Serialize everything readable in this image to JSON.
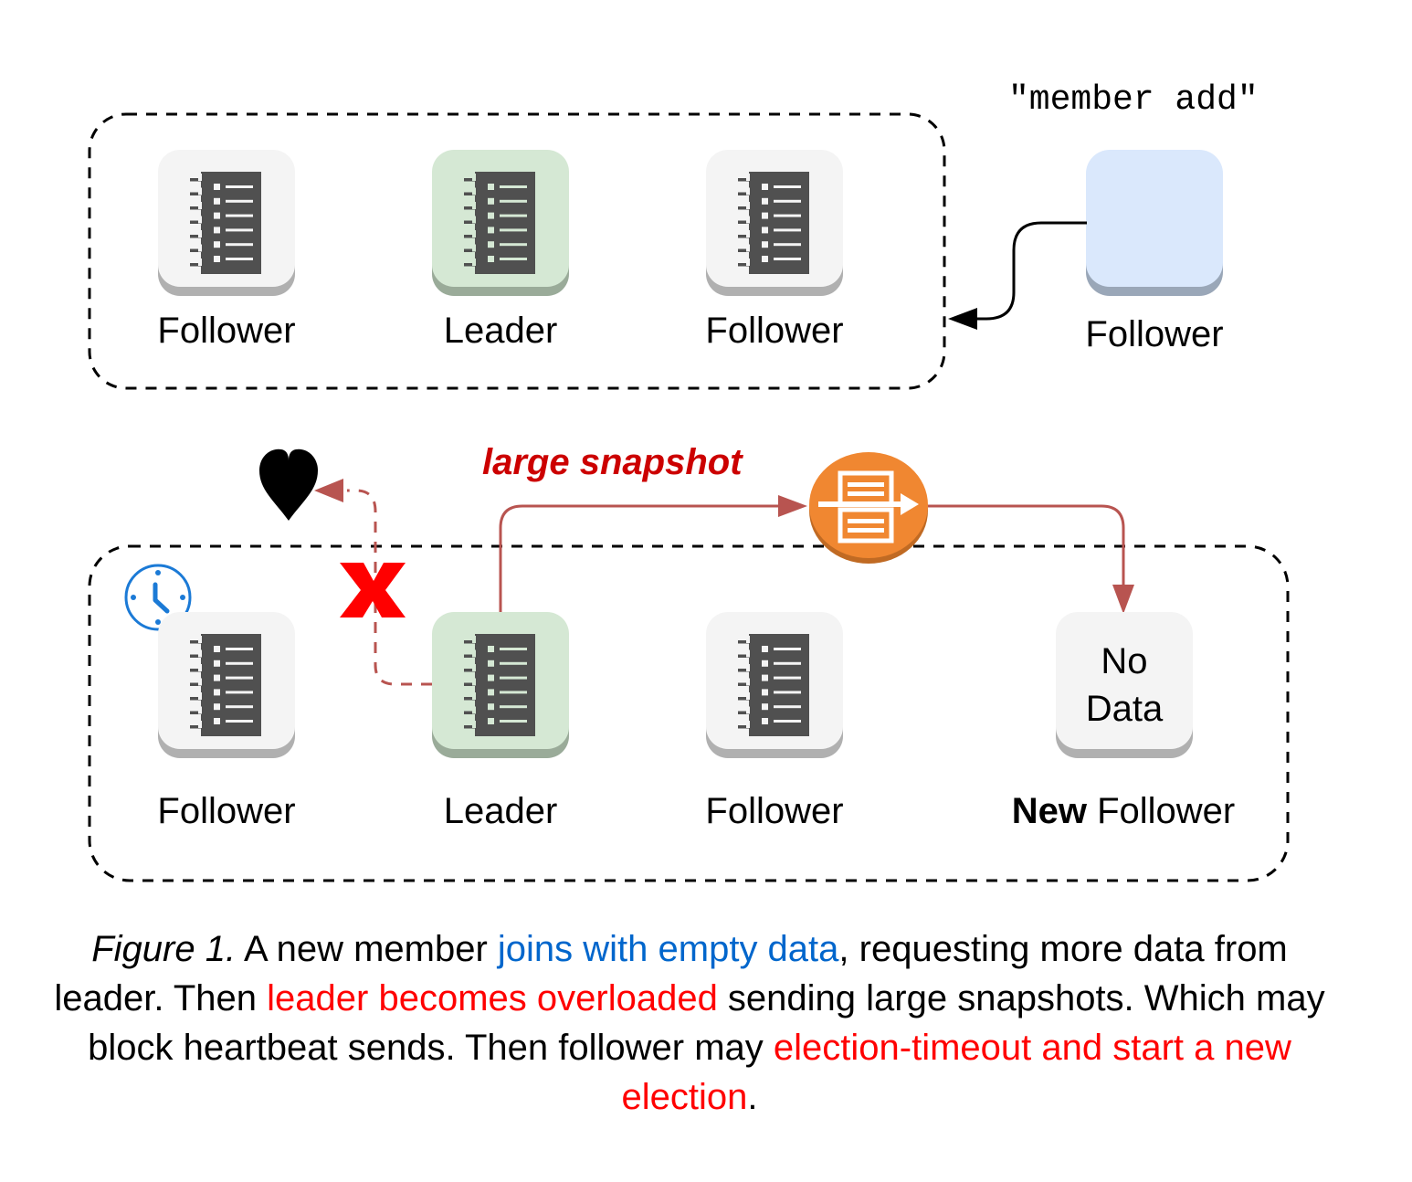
{
  "diagram": {
    "top_cluster": {
      "nodes": [
        {
          "label": "Follower",
          "role": "follower",
          "fill": "#f4f4f4",
          "shadow": "#b0b0b0"
        },
        {
          "label": "Leader",
          "role": "leader",
          "fill": "#d5e8d4",
          "shadow": "#9aab99"
        },
        {
          "label": "Follower",
          "role": "follower",
          "fill": "#f4f4f4",
          "shadow": "#b0b0b0"
        }
      ]
    },
    "joining_node": {
      "label": "Follower",
      "command": "\"member add\"",
      "fill": "#dae8fc",
      "shadow": "#9aa7b8"
    },
    "bottom_cluster": {
      "nodes": [
        {
          "label": "Follower",
          "role": "follower",
          "fill": "#f4f4f4",
          "shadow": "#b0b0b0"
        },
        {
          "label": "Leader",
          "role": "leader",
          "fill": "#d5e8d4",
          "shadow": "#9aab99"
        },
        {
          "label": "Follower",
          "role": "follower",
          "fill": "#f4f4f4",
          "shadow": "#b0b0b0"
        }
      ],
      "new_node": {
        "content_line1": "No",
        "content_line2": "Data",
        "label_bold": "New",
        "label_rest": " Follower"
      }
    },
    "snapshot_label": "large snapshot",
    "icons": {
      "heartbeat": "heart-icon",
      "blocked": "x-mark-icon",
      "timer": "clock-icon",
      "transfer": "snapshot-transfer-icon",
      "server": "server-list-icon"
    },
    "colors": {
      "arrow_red": "#b85450",
      "x_red": "#ff0000",
      "clock_blue": "#1b7ad6",
      "transfer_orange": "#f08731",
      "label_red": "#cc0000"
    }
  },
  "caption": {
    "figure_label": "Figure 1.",
    "part1": " A new member ",
    "highlight1": "joins with empty data",
    "part2": ", requesting more data from leader. Then ",
    "highlight2": "leader becomes overloaded",
    "part3": " sending large snapshots. Which may block heartbeat sends. Then follower may ",
    "highlight3": "election-timeout and start a new election",
    "part4": "."
  }
}
